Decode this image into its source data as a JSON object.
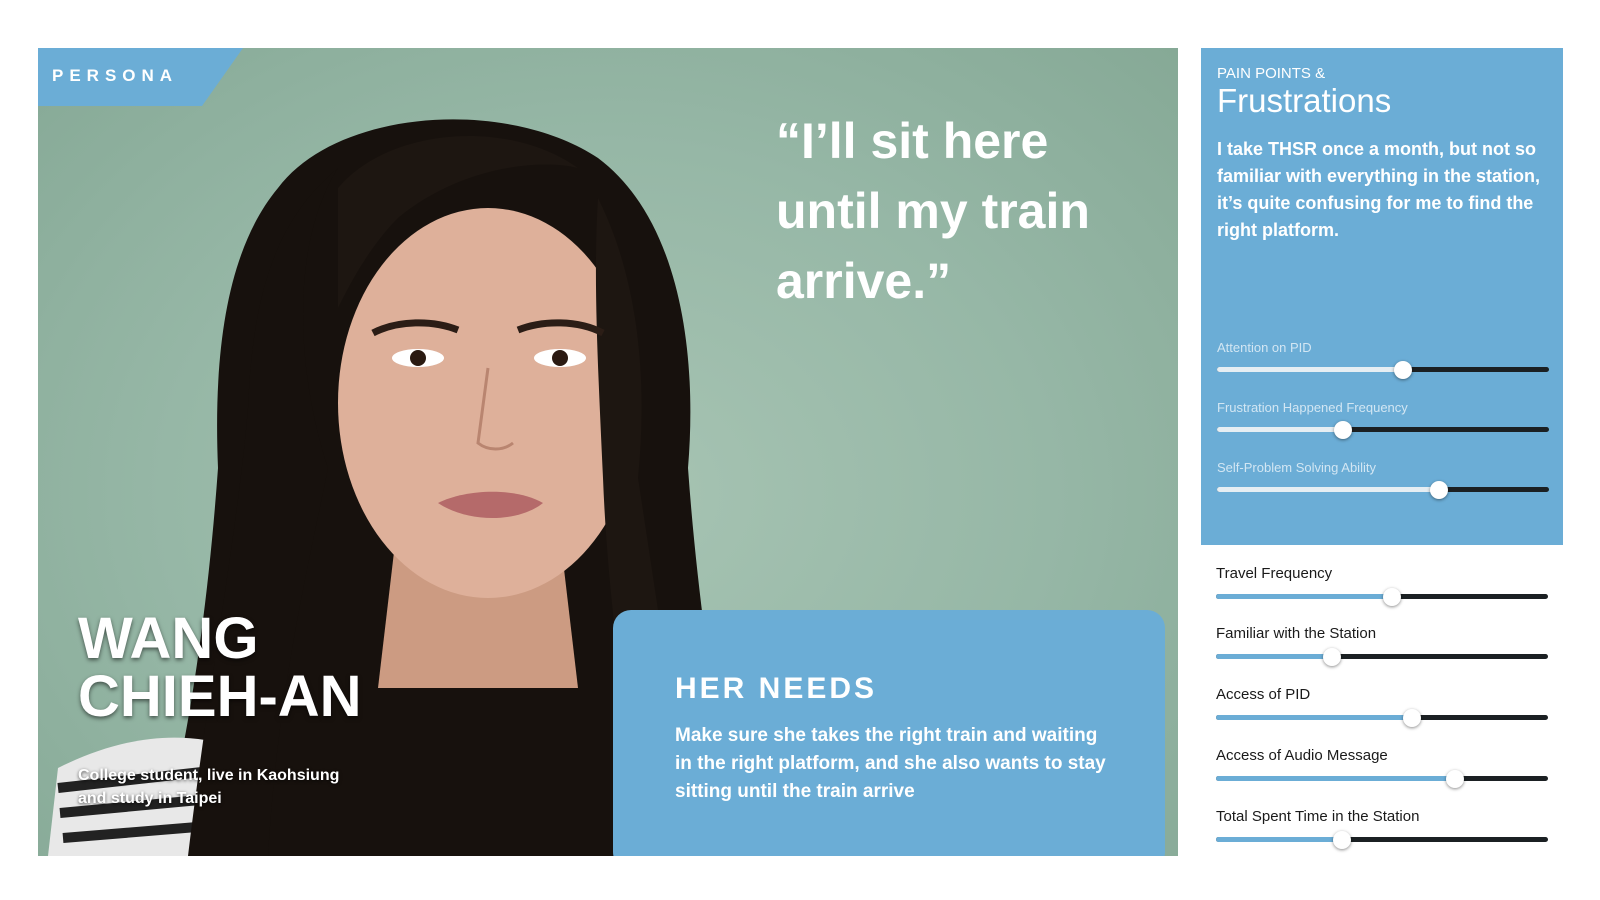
{
  "persona_tag": "PERSONA",
  "quote": [
    "“I’ll sit here",
    "until my train",
    "arrive.”"
  ],
  "name": [
    "WANG",
    "CHIEH-AN"
  ],
  "bio": "College student, live in Kaohsiung and study in Taipei",
  "needs": {
    "title": "HER NEEDS",
    "text": "Make sure she takes the right train and waiting in the right platform, and she also wants to stay sitting until the train arrive"
  },
  "pain_points": {
    "eyebrow": "PAIN POINTS &",
    "title": "Frustrations",
    "text": "I take THSR once a month, but not so familiar with everything in the station, it’s quite confusing for me to find the right platform.",
    "metrics": [
      {
        "label": "Attention on PID",
        "value": 0.56
      },
      {
        "label": "Frustration Happened Frequency",
        "value": 0.38
      },
      {
        "label": "Self-Problem Solving Ability",
        "value": 0.67
      }
    ]
  },
  "metrics": [
    {
      "label": "Travel Frequency",
      "value": 0.53
    },
    {
      "label": "Familiar with the Station",
      "value": 0.35
    },
    {
      "label": "Access of PID",
      "value": 0.59
    },
    {
      "label": "Access of Audio Message",
      "value": 0.72
    },
    {
      "label": "Total Spent Time in the Station",
      "value": 0.38
    }
  ],
  "colors": {
    "accent_blue": "#6badd6",
    "background_green": "#9dbcab",
    "slider_track": "#1b2023"
  }
}
